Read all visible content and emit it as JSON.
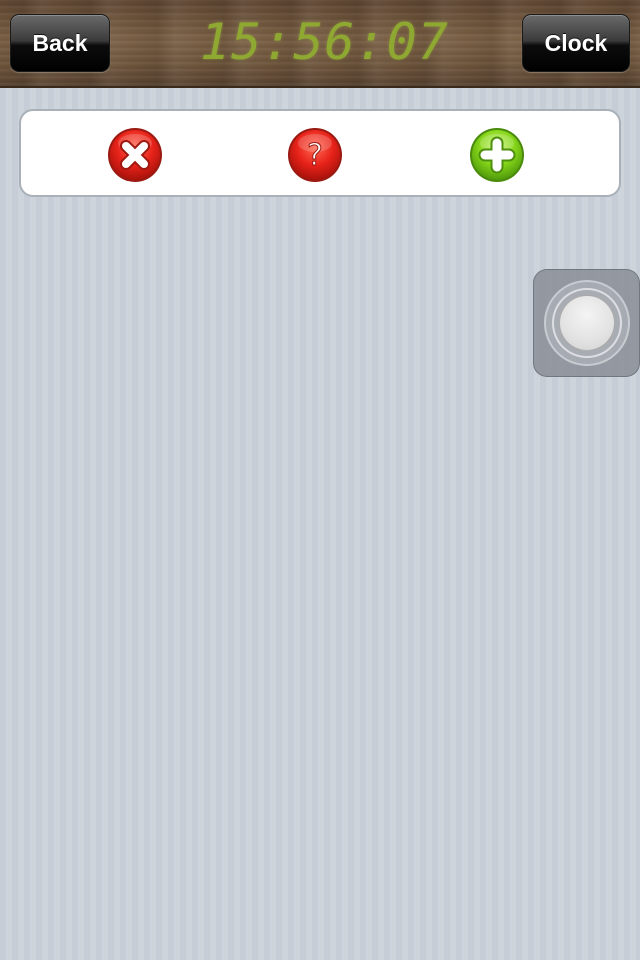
{
  "header": {
    "back_label": "Back",
    "time": "15:56:07",
    "clock_label": "Clock"
  },
  "actions": {
    "cancel_icon": "x-mark-icon",
    "help_icon": "question-mark-icon",
    "add_icon": "plus-icon",
    "help_glyph": "?"
  },
  "colors": {
    "clock_digits": "#8fa832",
    "cancel_red": "#e8231a",
    "help_red": "#e8231a",
    "add_green": "#86d61a"
  }
}
